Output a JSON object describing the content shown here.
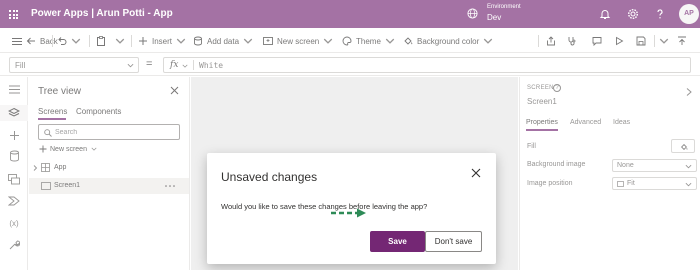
{
  "header": {
    "app_title": "Power Apps  |  Arun Potti - App",
    "environment_label": "Environment",
    "environment_name": "Dev",
    "avatar_initials": "AP",
    "brand_color": "#742774"
  },
  "commandbar": {
    "back": "Back",
    "insert": "Insert",
    "add_data": "Add data",
    "new_screen": "New screen",
    "theme": "Theme",
    "background_color": "Background color"
  },
  "formula": {
    "property": "Fill",
    "equals": "=",
    "fx": "fx",
    "value": "White"
  },
  "tree": {
    "title": "Tree view",
    "tabs": [
      "Screens",
      "Components"
    ],
    "search_placeholder": "Search",
    "new_screen": "New screen",
    "items": [
      {
        "label": "App"
      },
      {
        "label": "Screen1"
      }
    ]
  },
  "properties": {
    "kind": "SCREEN",
    "name": "Screen1",
    "tabs": [
      "Properties",
      "Advanced",
      "Ideas"
    ],
    "fill_label": "Fill",
    "background_image_label": "Background image",
    "background_image_value": "None",
    "image_position_label": "Image position",
    "image_position_value": "Fit"
  },
  "dialog": {
    "title": "Unsaved changes",
    "message": "Would you like to save these changes before leaving the app?",
    "save": "Save",
    "dont_save": "Don't save",
    "arrow_color": "#2e8b57"
  }
}
